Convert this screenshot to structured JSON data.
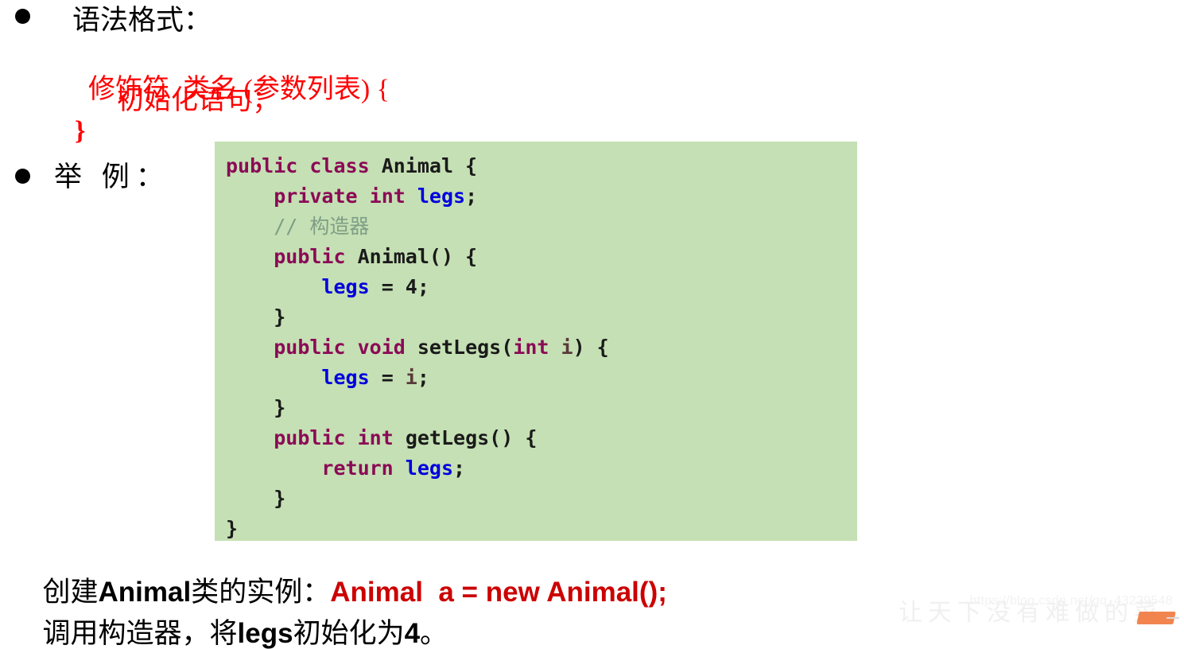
{
  "slide": {
    "background_color": "#FFFFFF",
    "bullets": [
      {
        "label": "语法格式："
      },
      {
        "label": "举 例："
      }
    ],
    "syntax_template": {
      "color": "#FF0000",
      "line1_plain": "修饰符  类名 ",
      "line1_bold": "(参数列表) {",
      "line2": "初始化语句；",
      "line3": "}"
    },
    "code_block": {
      "background_color": "#C5E0B4",
      "keyword_color": "#8B0A56",
      "field_color": "#0000DD",
      "param_color": "#5A3A3A",
      "comment_color": "#7E9E86",
      "plain_color": "#1A1A1A",
      "lines": {
        "l1_kw_public": "public",
        "l1_kw_class": "class",
        "l1_name": "Animal {",
        "l2_kw_private": "private",
        "l2_kw_int": "int",
        "l2_var": "legs",
        "l2_semi": ";",
        "l3_comment": "// 构造器",
        "l4_kw_public": "public",
        "l4_ctor": "Animal() {",
        "l5_var": "legs",
        "l5_rest": " = 4;",
        "l6_brace": "}",
        "l7_kw_public": "public",
        "l7_kw_void": "void",
        "l7_name": "setLegs(",
        "l7_kw_int": "int",
        "l7_param": "i",
        "l7_tail": ") {",
        "l8_var": "legs",
        "l8_eq": " = ",
        "l8_param": "i",
        "l8_semi": ";",
        "l9_brace": "}",
        "l10_kw_public": "public",
        "l10_kw_int": "int",
        "l10_name": "getLegs() {",
        "l11_kw_return": "return",
        "l11_var": "legs",
        "l11_semi": ";",
        "l12_brace": "}",
        "l13_brace": "}"
      }
    },
    "description": {
      "line1_prefix": "创建",
      "line1_latin1": "Animal",
      "line1_mid": "类的实例：",
      "line1_code": "Animal  a = new Animal();",
      "line2_prefix": "调用构造器，将",
      "line2_latin": "legs",
      "line2_mid": "初始化为",
      "line2_num": "4",
      "line2_suffix": "。"
    }
  },
  "watermark": {
    "url": "https://blog.csdn.net/qq_43229548",
    "calligraphy": "让天下没有难做的菜"
  }
}
